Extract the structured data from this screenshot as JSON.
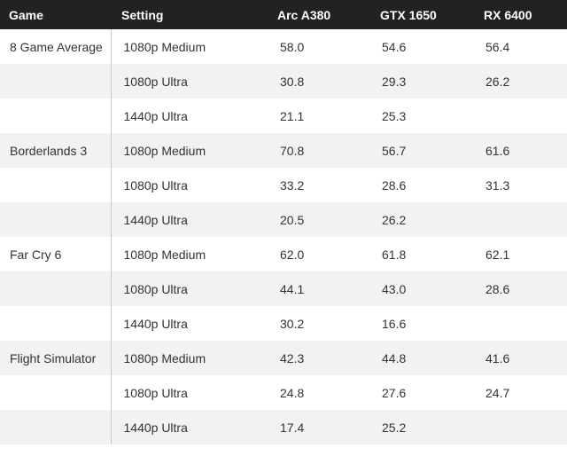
{
  "headers": {
    "game": "Game",
    "setting": "Setting",
    "gpu1": "Arc A380",
    "gpu2": "GTX 1650",
    "gpu3": "RX 6400"
  },
  "rows": [
    {
      "game": "8 Game Average",
      "setting": "1080p Medium",
      "a": "58.0",
      "b": "54.6",
      "c": "56.4"
    },
    {
      "game": "",
      "setting": "1080p Ultra",
      "a": "30.8",
      "b": "29.3",
      "c": "26.2"
    },
    {
      "game": "",
      "setting": "1440p Ultra",
      "a": "21.1",
      "b": "25.3",
      "c": ""
    },
    {
      "game": "Borderlands 3",
      "setting": "1080p Medium",
      "a": "70.8",
      "b": "56.7",
      "c": "61.6"
    },
    {
      "game": "",
      "setting": "1080p Ultra",
      "a": "33.2",
      "b": "28.6",
      "c": "31.3"
    },
    {
      "game": "",
      "setting": "1440p Ultra",
      "a": "20.5",
      "b": "26.2",
      "c": ""
    },
    {
      "game": "Far Cry 6",
      "setting": "1080p Medium",
      "a": "62.0",
      "b": "61.8",
      "c": "62.1"
    },
    {
      "game": "",
      "setting": "1080p Ultra",
      "a": "44.1",
      "b": "43.0",
      "c": "28.6"
    },
    {
      "game": "",
      "setting": "1440p Ultra",
      "a": "30.2",
      "b": "16.6",
      "c": ""
    },
    {
      "game": "Flight Simulator",
      "setting": "1080p Medium",
      "a": "42.3",
      "b": "44.8",
      "c": "41.6"
    },
    {
      "game": "",
      "setting": "1080p Ultra",
      "a": "24.8",
      "b": "27.6",
      "c": "24.7"
    },
    {
      "game": "",
      "setting": "1440p Ultra",
      "a": "17.4",
      "b": "25.2",
      "c": ""
    }
  ]
}
